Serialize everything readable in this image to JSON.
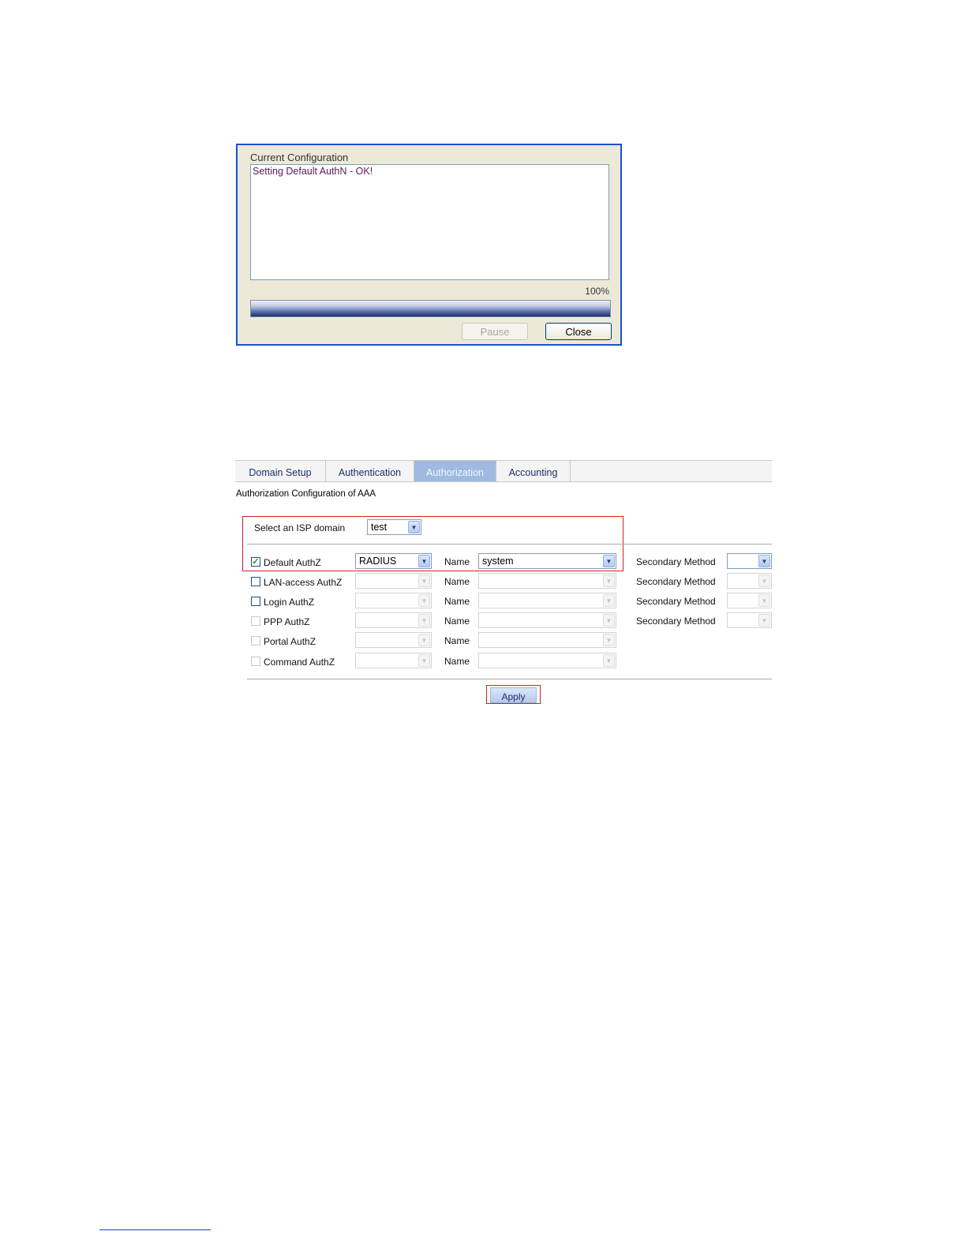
{
  "dialog": {
    "title": "Current Configuration",
    "log": "Setting Default AuthN - OK!",
    "progress_percent_label": "100%",
    "progress_fraction": 1.0,
    "pause_label": "Pause",
    "close_label": "Close"
  },
  "tabs": [
    {
      "label": "Domain Setup",
      "active": false
    },
    {
      "label": "Authentication",
      "active": false
    },
    {
      "label": "Authorization",
      "active": true
    },
    {
      "label": "Accounting",
      "active": false
    }
  ],
  "section_title": "Authorization Configuration of AAA",
  "isp_domain": {
    "label": "Select an ISP domain",
    "value": "test"
  },
  "name_label": "Name",
  "secondary_label": "Secondary Method",
  "rows": [
    {
      "label": "Default AuthZ",
      "checked": true,
      "method": "RADIUS",
      "name": "system",
      "secondary": true
    },
    {
      "label": "LAN-access AuthZ",
      "checked": false,
      "method": "",
      "name": "",
      "secondary": true
    },
    {
      "label": "Login AuthZ",
      "checked": false,
      "method": "",
      "name": "",
      "secondary": true
    },
    {
      "label": "PPP AuthZ",
      "checked": false,
      "method": "",
      "name": "",
      "secondary": true
    },
    {
      "label": "Portal AuthZ",
      "checked": false,
      "method": "",
      "name": "",
      "secondary": false
    },
    {
      "label": "Command AuthZ",
      "checked": false,
      "method": "",
      "name": "",
      "secondary": false
    }
  ],
  "apply_label": "Apply",
  "colors": {
    "dialog_border": "#1a4fd6",
    "highlight_red": "#d32020",
    "active_tab": "#9fb9e0"
  }
}
